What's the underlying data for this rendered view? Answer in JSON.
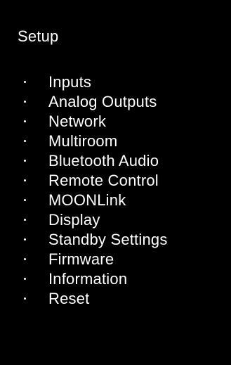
{
  "title": "Setup",
  "colors": {
    "background": "#000000",
    "text": "#ffffff"
  },
  "menu": {
    "items": [
      {
        "label": "Inputs"
      },
      {
        "label": "Analog Outputs"
      },
      {
        "label": "Network"
      },
      {
        "label": "Multiroom"
      },
      {
        "label": "Bluetooth Audio"
      },
      {
        "label": "Remote Control"
      },
      {
        "label": "MOONLink"
      },
      {
        "label": "Display"
      },
      {
        "label": "Standby Settings"
      },
      {
        "label": "Firmware"
      },
      {
        "label": "Information"
      },
      {
        "label": "Reset"
      }
    ]
  }
}
